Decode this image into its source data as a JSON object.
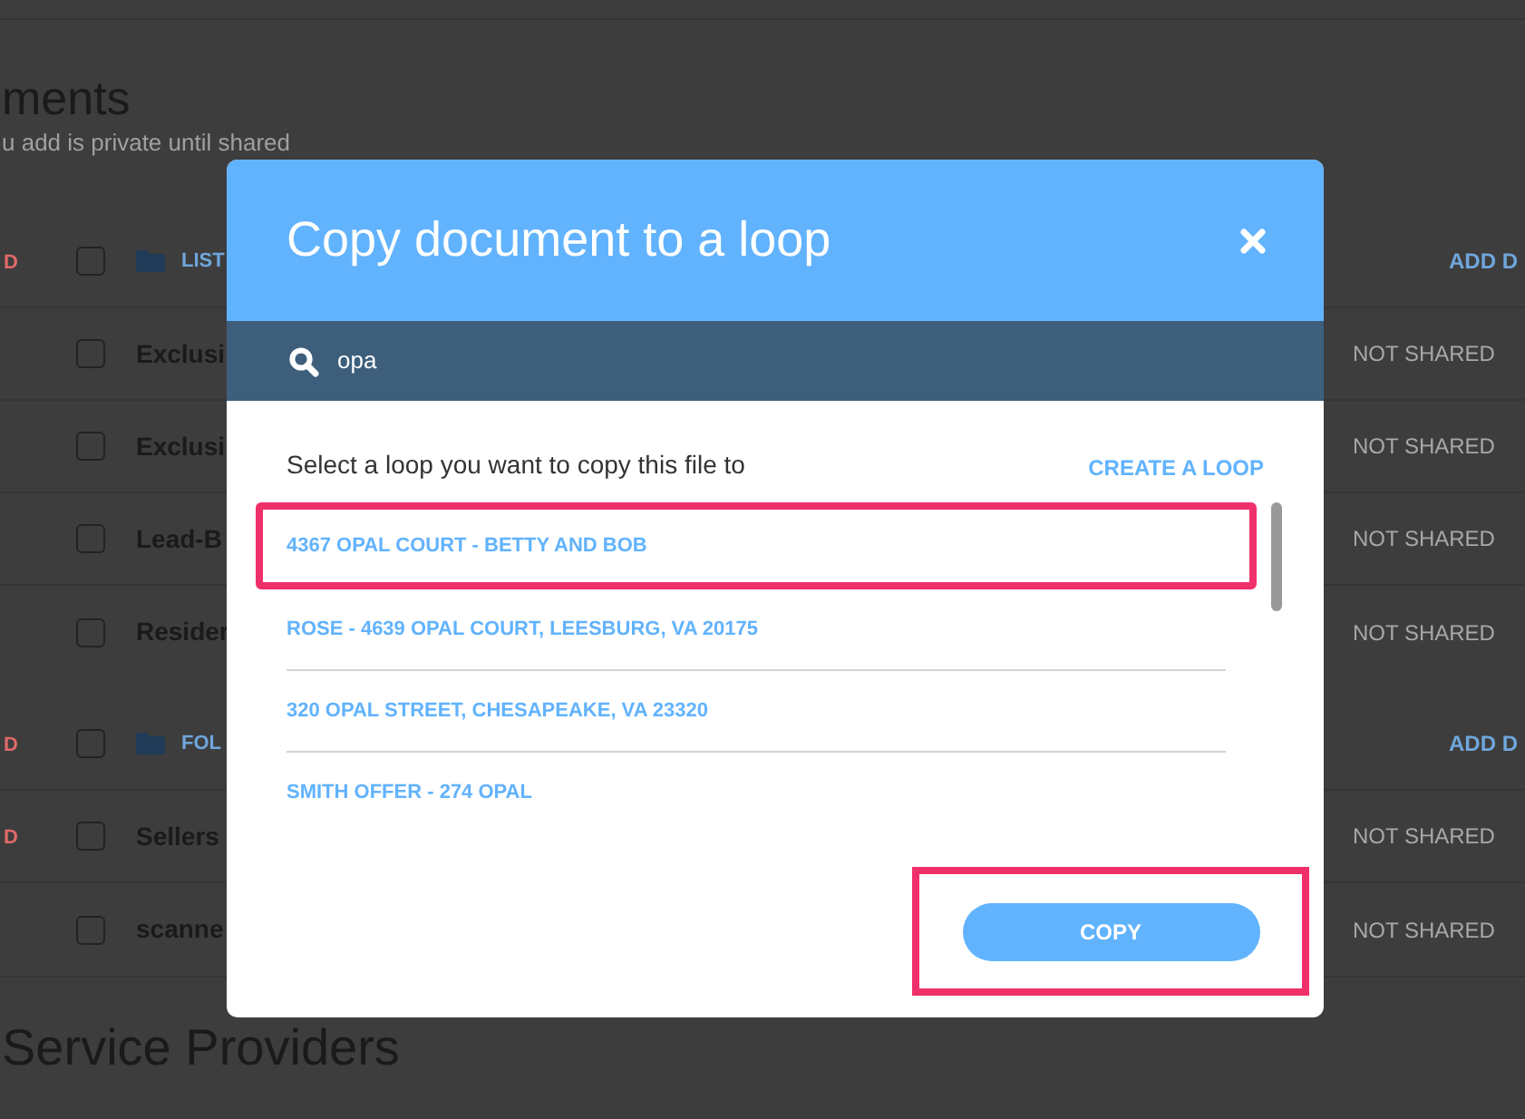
{
  "page": {
    "heading": "ments",
    "subtitle": "u add is private until shared",
    "sections": [
      {
        "rows": [
          {
            "kind": "header",
            "flag": "D",
            "label": "LIST",
            "action": "ADD D",
            "checked": false
          },
          {
            "kind": "document",
            "label": "Exclusi",
            "status": "NOT SHARED",
            "checked": false
          },
          {
            "kind": "document",
            "label": "Exclusi",
            "status": "NOT SHARED",
            "checked": false
          },
          {
            "kind": "document",
            "label": "Lead-B",
            "status": "NOT SHARED",
            "checked": false
          },
          {
            "kind": "document",
            "label": "Resider",
            "status": "NOT SHARED",
            "checked": false
          }
        ]
      },
      {
        "rows": [
          {
            "kind": "header",
            "flag": "D",
            "label": "FOL",
            "action": "ADD D",
            "checked": false
          },
          {
            "kind": "document",
            "flag": "D",
            "label": "Sellers",
            "status": "NOT SHARED",
            "checked": false
          },
          {
            "kind": "document",
            "label": "scanne",
            "status": "NOT SHARED",
            "checked": false
          }
        ]
      }
    ],
    "footer_heading": "Service Providers"
  },
  "dialog": {
    "title": "Copy document to a loop",
    "search": {
      "value": "opa"
    },
    "prompt": "Select a loop you want to copy this file to",
    "create_link": "CREATE A LOOP",
    "loops": [
      {
        "label": "4367 OPAL COURT - BETTY AND BOB",
        "annotated": true
      },
      {
        "label": "ROSE - 4639 OPAL COURT, LEESBURG, VA 20175",
        "annotated": false
      },
      {
        "label": "320 OPAL STREET, CHESAPEAKE, VA 23320",
        "annotated": false
      },
      {
        "label": "SMITH OFFER - 274 OPAL",
        "annotated": false
      }
    ],
    "copy_button": {
      "label": "COPY",
      "annotated": true
    }
  }
}
